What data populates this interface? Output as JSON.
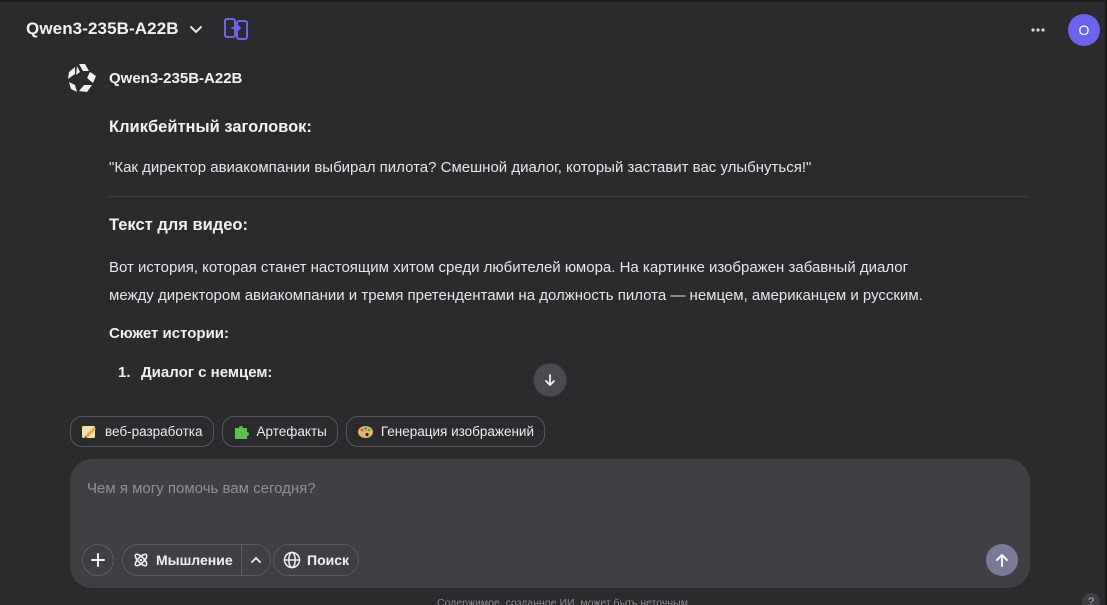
{
  "header": {
    "model_name": "Qwen3-235B-A22B",
    "avatar_initial": "O"
  },
  "message": {
    "bot_name": "Qwen3-235B-A22B",
    "heading_1": "Кликбейтный заголовок:",
    "headline_quote": "\"Как директор авиакомпании выбирал пилота? Смешной диалог, который заставит вас улыбнуться!\"",
    "heading_2": "Текст для видео:",
    "paragraph_line1": "Вот история, которая станет настоящим хитом среди любителей юмора. На картинке изображен забавный диалог",
    "paragraph_line2": "между директором авиакомпании и тремя претендентами на должность пилота — немцем, американцем и русским.",
    "plot_label": "Сюжет истории:",
    "list_items": [
      {
        "number": "1.",
        "text": "Диалог с немцем:"
      }
    ]
  },
  "chips": [
    {
      "label": "веб-разработка",
      "icon": "pencil-emoji-icon"
    },
    {
      "label": "Артефакты",
      "icon": "puzzle-emoji-icon"
    },
    {
      "label": "Генерация изображений",
      "icon": "palette-emoji-icon"
    }
  ],
  "composer": {
    "placeholder": "Чем я могу помочь вам сегодня?",
    "thinking_label": "Мышление",
    "search_label": "Поиск"
  },
  "footer": {
    "disclaimer": "Содержимое, созданное ИИ, может быть неточным.",
    "help_label": "?"
  },
  "colors": {
    "background": "#2b2b2e",
    "input_bg": "#3f3f44",
    "accent": "#6b63f0",
    "send_bg": "#7a7a96"
  }
}
